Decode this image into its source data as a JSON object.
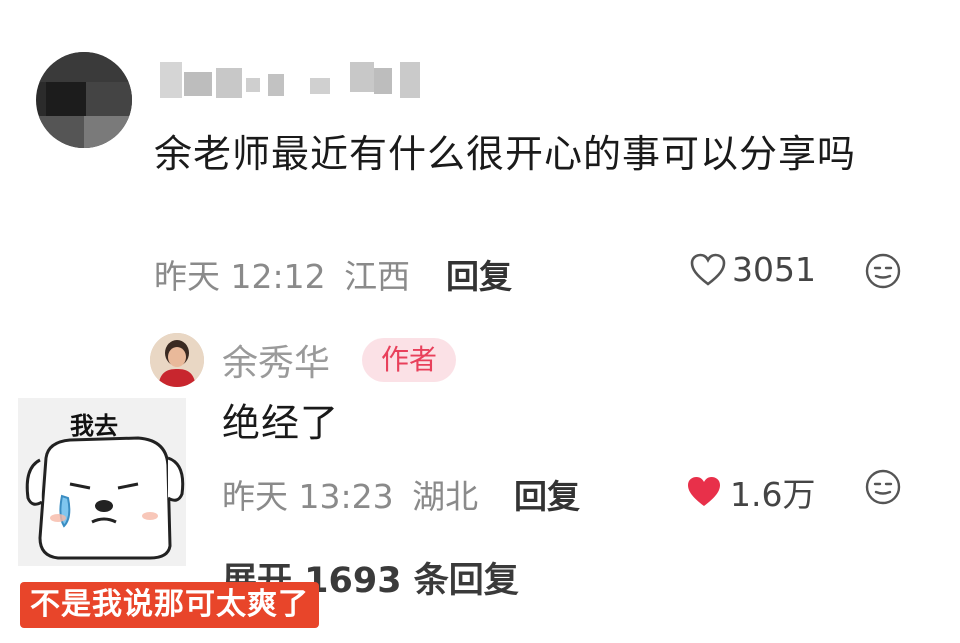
{
  "comment": {
    "text": "余老师最近有什么很开心的事可以分享吗",
    "time": "昨天 12:12",
    "location": "江西",
    "reply_label": "回复",
    "likes": "3051",
    "like_icon": "heart-outline-icon",
    "emoji_icon": "emoji-face-icon"
  },
  "reply": {
    "author": "余秀华",
    "badge": "作者",
    "text": "绝经了",
    "time": "昨天 13:23",
    "location": "湖北",
    "reply_label": "回复",
    "likes": "1.6万",
    "like_icon": "heart-filled-icon",
    "like_color": "#e8304a",
    "emoji_icon": "emoji-face-icon"
  },
  "expand": {
    "text": "展开 1693 条回复"
  },
  "sticker": {
    "label": "我去"
  },
  "caption": {
    "text": "不是我说那可太爽了",
    "color": "#e8452a"
  }
}
